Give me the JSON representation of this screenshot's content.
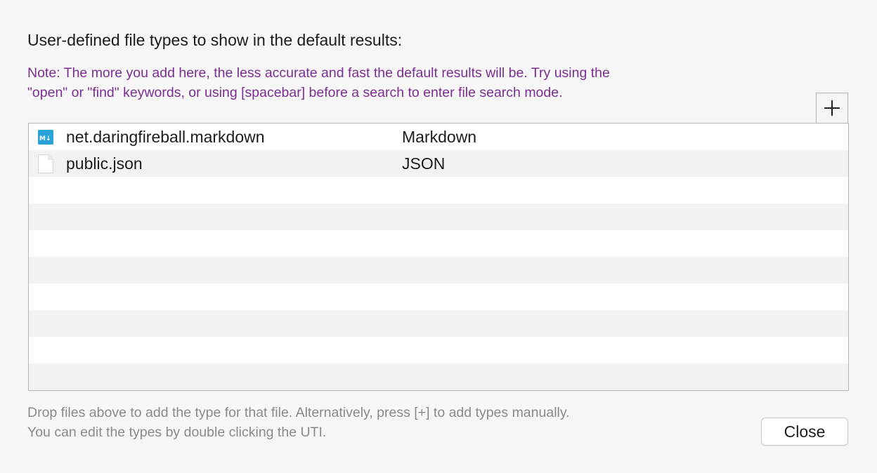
{
  "dialog": {
    "heading": "User-defined file types to show in the default results:",
    "note_line1": "Note: The more you add here, the less accurate and fast the default results will be. Try using the",
    "note_line2": "\"open\" or \"find\" keywords, or using [spacebar] before a search to enter file search mode.",
    "add_button_label": "+",
    "footer_line1": "Drop files above to add the type for that file. Alternatively, press [+] to add types manually.",
    "footer_line2": "You can edit the types by double clicking the UTI.",
    "close_label": "Close"
  },
  "file_types": [
    {
      "uti": "net.daringfireball.markdown",
      "name": "Markdown",
      "icon": "markdown-file-icon"
    },
    {
      "uti": "public.json",
      "name": "JSON",
      "icon": "document-file-icon"
    }
  ],
  "colors": {
    "note_text": "#7a2e8f",
    "footer_text": "#8a8a8a",
    "markdown_icon": "#2aa3d8"
  }
}
